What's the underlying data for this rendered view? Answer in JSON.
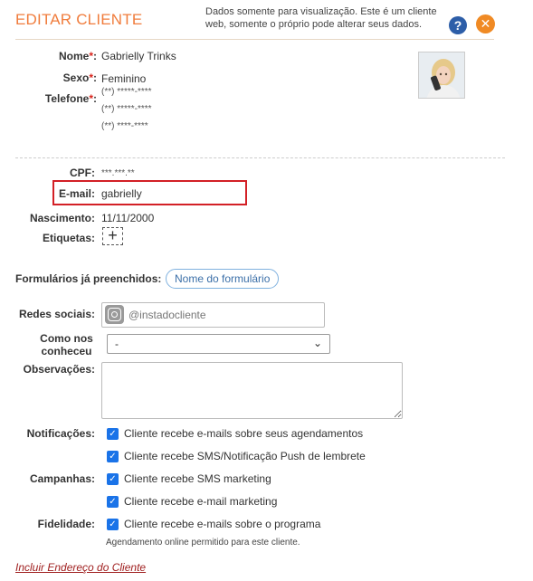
{
  "header": {
    "title": "EDITAR CLIENTE",
    "notice": "Dados somente para visualização. Este é um cliente web, somente o próprio pode alterar seus dados.",
    "help_icon": "question-circle-icon",
    "close_icon": "close-circle-icon",
    "help_glyph": "?",
    "close_glyph": "✕"
  },
  "client": {
    "nome_label": "Nome",
    "nome_value": "Gabrielly Trinks",
    "sexo_label": "Sexo",
    "sexo_value": "Feminino",
    "telefone_label": "Telefone",
    "phones": [
      "(**) *****-****",
      "(**) *****-****",
      "(**) ****-****"
    ],
    "required_mark": "*",
    "label_suffix": ":",
    "cpf_label": "CPF:",
    "cpf_value": "***.***.**",
    "email_label": "E-mail:",
    "email_value": "gabrielly",
    "nascimento_label": "Nascimento:",
    "nascimento_value": "11/11/2000",
    "etiquetas_label": "Etiquetas:",
    "add_tag_glyph": "+"
  },
  "forms": {
    "label": "Formulários já preenchidos:",
    "pill": "Nome do formulário"
  },
  "social": {
    "label": "Redes sociais:",
    "placeholder": "@instadocliente",
    "icon": "instagram-icon"
  },
  "como_nos_conheceu": {
    "label_line1": "Como nos",
    "label_line2": "conheceu",
    "selected": "-",
    "chevron": "⌄"
  },
  "observacoes": {
    "label": "Observações:"
  },
  "notificacoes": {
    "label": "Notificações:",
    "items": [
      "Cliente recebe e-mails sobre seus agendamentos",
      "Cliente recebe SMS/Notificação Push de lembrete"
    ]
  },
  "campanhas": {
    "label": "Campanhas:",
    "items": [
      "Cliente recebe SMS marketing",
      "Cliente recebe e-mail marketing"
    ]
  },
  "fidelidade": {
    "label": "Fidelidade:",
    "items": [
      "Cliente recebe e-mails sobre o programa"
    ]
  },
  "checkmark": "✓",
  "footnote": "Agendamento online permitido para este cliente.",
  "address_link": "Incluir Endereço do Cliente",
  "colors": {
    "title": "#f07c3c",
    "close": "#f08a24",
    "help": "#2d5ea8",
    "highlight": "#d32026",
    "checkbox": "#1a73e8",
    "link": "#a02020"
  }
}
